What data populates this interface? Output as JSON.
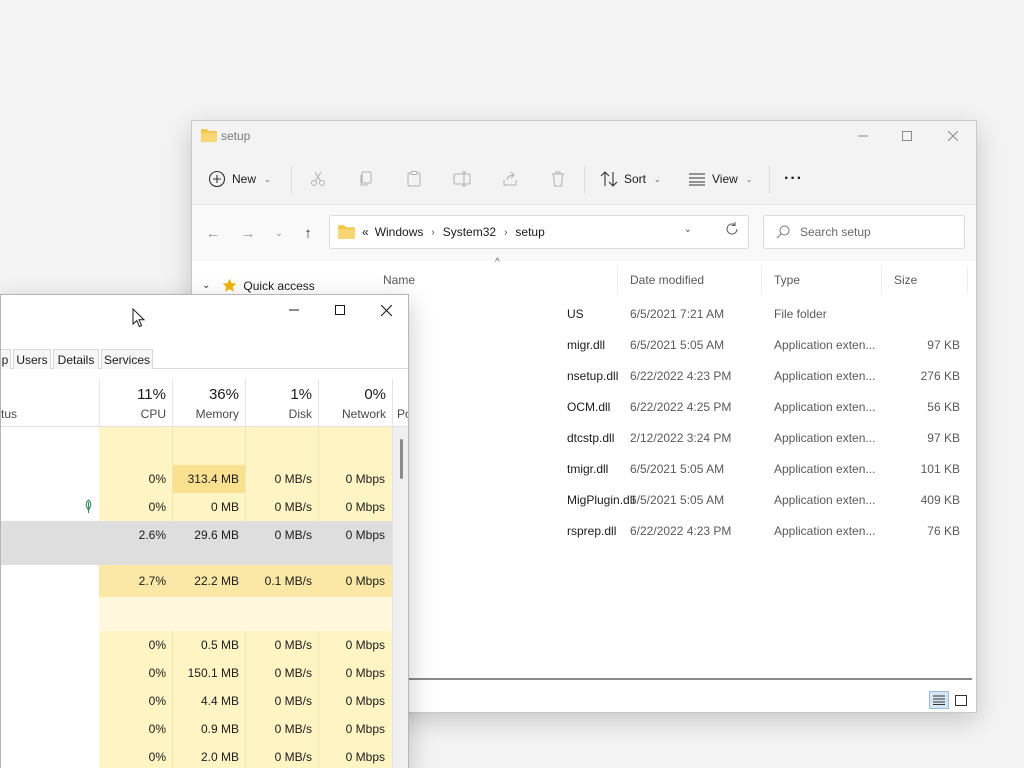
{
  "explorer": {
    "title": "setup",
    "toolbar": {
      "new_label": "New",
      "sort_label": "Sort",
      "view_label": "View",
      "more_label": "···"
    },
    "address": {
      "overflow": "«",
      "crumbs": [
        "Windows",
        "System32",
        "setup"
      ]
    },
    "search_placeholder": "Search setup",
    "nav": {
      "quick_access": "Quick access"
    },
    "columns": {
      "name": "Name",
      "date": "Date modified",
      "type": "Type",
      "size": "Size"
    },
    "files": [
      {
        "name": "US",
        "date": "6/5/2021 7:21 AM",
        "type": "File folder",
        "size": ""
      },
      {
        "name": "migr.dll",
        "date": "6/5/2021 5:05 AM",
        "type": "Application exten...",
        "size": "97 KB"
      },
      {
        "name": "nsetup.dll",
        "date": "6/22/2022 4:23 PM",
        "type": "Application exten...",
        "size": "276 KB"
      },
      {
        "name": "OCM.dll",
        "date": "6/22/2022 4:25 PM",
        "type": "Application exten...",
        "size": "56 KB"
      },
      {
        "name": "dtcstp.dll",
        "date": "2/12/2022 3:24 PM",
        "type": "Application exten...",
        "size": "97 KB"
      },
      {
        "name": "tmigr.dll",
        "date": "6/5/2021 5:05 AM",
        "type": "Application exten...",
        "size": "101 KB"
      },
      {
        "name": "MigPlugin.dll",
        "date": "6/5/2021 5:05 AM",
        "type": "Application exten...",
        "size": "409 KB"
      },
      {
        "name": "rsprep.dll",
        "date": "6/22/2022 4:23 PM",
        "type": "Application exten...",
        "size": "76 KB"
      }
    ]
  },
  "taskmgr": {
    "tabs": [
      "p",
      "Users",
      "Details",
      "Services"
    ],
    "columns": {
      "cpu": {
        "pct": "11%",
        "label": "CPU"
      },
      "memory": {
        "pct": "36%",
        "label": "Memory"
      },
      "disk": {
        "pct": "1%",
        "label": "Disk"
      },
      "network": {
        "pct": "0%",
        "label": "Network"
      },
      "power": {
        "label": "Po"
      }
    },
    "status_label": "tus",
    "rows": [
      {
        "cpu": "0%",
        "memory": "313.4 MB",
        "disk": "0 MB/s",
        "network": "0 Mbps"
      },
      {
        "cpu": "0%",
        "memory": "0 MB",
        "disk": "0 MB/s",
        "network": "0 Mbps"
      },
      {
        "cpu": "2.6%",
        "memory": "29.6 MB",
        "disk": "0 MB/s",
        "network": "0 Mbps"
      },
      {
        "cpu": "2.7%",
        "memory": "22.2 MB",
        "disk": "0.1 MB/s",
        "network": "0 Mbps"
      },
      {
        "cpu": "0%",
        "memory": "0.5 MB",
        "disk": "0 MB/s",
        "network": "0 Mbps"
      },
      {
        "cpu": "0%",
        "memory": "150.1 MB",
        "disk": "0 MB/s",
        "network": "0 Mbps"
      },
      {
        "cpu": "0%",
        "memory": "4.4 MB",
        "disk": "0 MB/s",
        "network": "0 Mbps"
      },
      {
        "cpu": "0%",
        "memory": "0.9 MB",
        "disk": "0 MB/s",
        "network": "0 Mbps"
      },
      {
        "cpu": "0%",
        "memory": "2.0 MB",
        "disk": "0 MB/s",
        "network": "0 Mbps"
      }
    ]
  },
  "colors": {
    "accent": "#0067c0",
    "heat_light": "#fff4c4",
    "heat_medium": "#f9e18f",
    "selection": "#dedede",
    "folder": "#f2c94c"
  }
}
